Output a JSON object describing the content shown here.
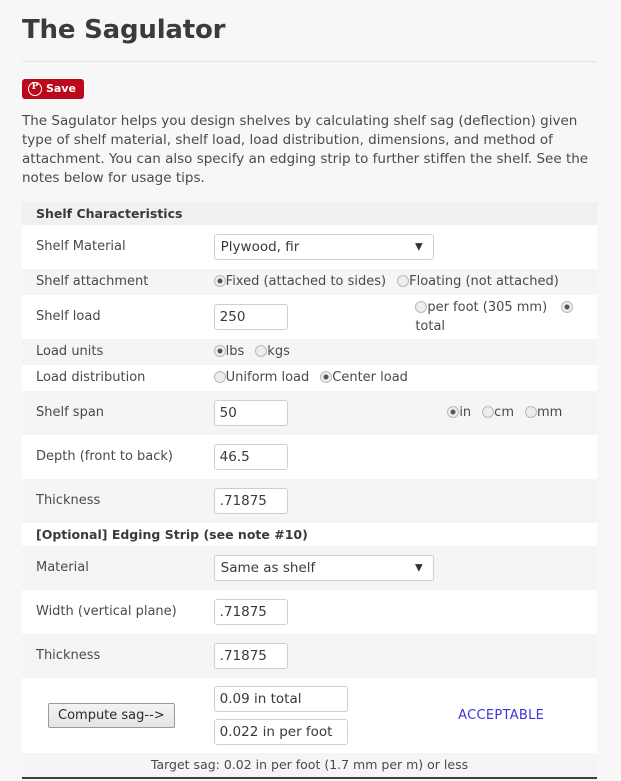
{
  "header": {
    "title": "The Sagulator",
    "save_button_label": "Save",
    "save_icon": "pinterest-p-icon"
  },
  "intro": {
    "text": "The Sagulator helps you design shelves by calculating shelf sag (deflection) given type of shelf material, shelf load, load distribution, dimensions, and method of attachment. You can also specify an edging strip to further stiffen the shelf. See the notes below for usage tips."
  },
  "shelf_section": {
    "heading": "Shelf Characteristics",
    "material": {
      "label": "Shelf Material",
      "value": "Plywood, fir",
      "options": [
        "Plywood, fir"
      ]
    },
    "attachment": {
      "label": "Shelf attachment",
      "options": [
        {
          "label": "Fixed (attached to sides)",
          "selected": true
        },
        {
          "label": "Floating (not attached)",
          "selected": false
        }
      ]
    },
    "load": {
      "label": "Shelf load",
      "value": "250",
      "options": [
        {
          "label": "per foot (305 mm)",
          "selected": false
        },
        {
          "label": "total",
          "selected": true
        }
      ]
    },
    "load_units": {
      "label": "Load units",
      "options": [
        {
          "label": "lbs",
          "selected": true
        },
        {
          "label": "kgs",
          "selected": false
        }
      ]
    },
    "load_distribution": {
      "label": "Load distribution",
      "options": [
        {
          "label": "Uniform load",
          "selected": false
        },
        {
          "label": "Center load",
          "selected": true
        }
      ]
    },
    "span": {
      "label": "Shelf span",
      "value": "50",
      "units": [
        {
          "label": "in",
          "selected": true
        },
        {
          "label": "cm",
          "selected": false
        },
        {
          "label": "mm",
          "selected": false
        }
      ]
    },
    "depth": {
      "label": "Depth (front to back)",
      "value": "46.5"
    },
    "thickness": {
      "label": "Thickness",
      "value": ".71875"
    }
  },
  "edging_section": {
    "heading": "[Optional]  Edging Strip (see note #10)",
    "material": {
      "label": "Material",
      "value": "Same as shelf",
      "options": [
        "Same as shelf"
      ]
    },
    "width": {
      "label": "Width (vertical plane)",
      "value": ".71875"
    },
    "thickness": {
      "label": "Thickness",
      "value": ".71875"
    }
  },
  "compute": {
    "button_label": "Compute sag-->",
    "result_total": "0.09 in total",
    "result_per_foot": "0.022 in per foot",
    "status": "ACCEPTABLE",
    "status_color": "#3a36d8",
    "target_sag": "Target sag: 0.02 in per foot (1.7 mm per m) or less"
  }
}
